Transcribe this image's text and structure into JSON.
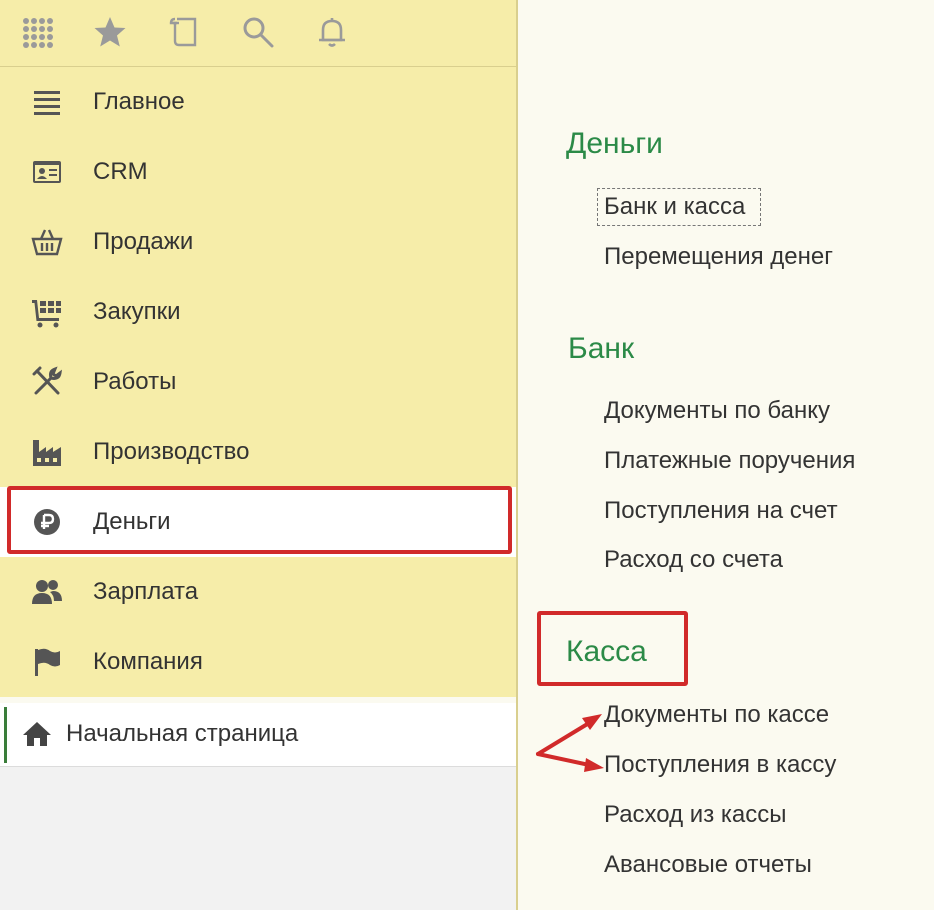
{
  "toolbar": {
    "icons": [
      "apps-grid-icon",
      "favorites-star-icon",
      "history-icon",
      "search-icon",
      "notifications-bell-icon"
    ]
  },
  "sidebar": {
    "items": [
      {
        "label": "Главное",
        "icon": "menu-lines-icon"
      },
      {
        "label": "CRM",
        "icon": "contact-card-icon"
      },
      {
        "label": "Продажи",
        "icon": "basket-icon"
      },
      {
        "label": "Закупки",
        "icon": "cart-icon"
      },
      {
        "label": "Работы",
        "icon": "tools-icon"
      },
      {
        "label": "Производство",
        "icon": "factory-icon"
      },
      {
        "label": "Деньги",
        "icon": "money-icon",
        "active": true
      },
      {
        "label": "Зарплата",
        "icon": "people-icon"
      },
      {
        "label": "Компания",
        "icon": "flag-icon"
      }
    ],
    "home": {
      "label": "Начальная страница",
      "icon": "home-icon"
    }
  },
  "content": {
    "sections": [
      {
        "title": "Деньги",
        "links": [
          "Банк и касса",
          "Перемещения денег"
        ]
      },
      {
        "title": "Банк",
        "links": [
          "Документы по банку",
          "Платежные поручения",
          "Поступления на счет",
          "Расход со счета"
        ]
      },
      {
        "title": "Касса",
        "links": [
          "Документы по кассе",
          "Поступления в кассу",
          "Расход из кассы",
          "Авансовые отчеты"
        ]
      }
    ]
  },
  "colors": {
    "sidebar_bg": "#f6eda9",
    "section_title": "#2b8a47",
    "annotation_red": "#d12a2a",
    "icon_gray": "#555555"
  }
}
